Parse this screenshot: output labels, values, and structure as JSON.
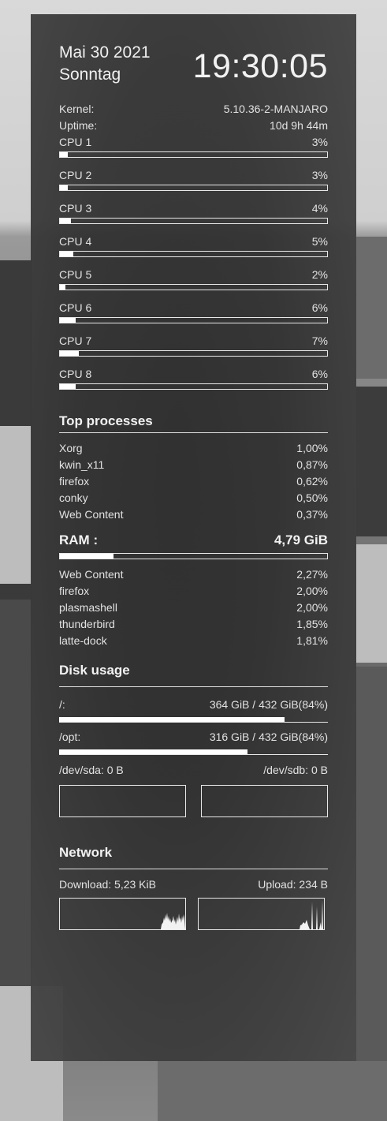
{
  "header": {
    "date": "Mai 30 2021",
    "weekday": "Sonntag",
    "time": "19:30:05"
  },
  "system": {
    "kernel_label": "Kernel:",
    "kernel_value": "5.10.36-2-MANJARO",
    "uptime_label": "Uptime:",
    "uptime_value": "10d 9h 44m"
  },
  "cpus": [
    {
      "label": "CPU 1",
      "value": "3%",
      "percent": 3
    },
    {
      "label": "CPU 2",
      "value": "3%",
      "percent": 3
    },
    {
      "label": "CPU 3",
      "value": "4%",
      "percent": 4
    },
    {
      "label": "CPU 4",
      "value": "5%",
      "percent": 5
    },
    {
      "label": "CPU 5",
      "value": "2%",
      "percent": 2
    },
    {
      "label": "CPU 6",
      "value": "6%",
      "percent": 6
    },
    {
      "label": "CPU 7",
      "value": "7%",
      "percent": 7
    },
    {
      "label": "CPU 8",
      "value": "6%",
      "percent": 6
    }
  ],
  "top_processes": {
    "title": "Top processes",
    "items": [
      {
        "name": "Xorg",
        "value": "1,00%"
      },
      {
        "name": "kwin_x11",
        "value": "0,87%"
      },
      {
        "name": "firefox",
        "value": "0,62%"
      },
      {
        "name": "conky",
        "value": "0,50%"
      },
      {
        "name": "Web Content",
        "value": "0,37%"
      }
    ]
  },
  "ram": {
    "title": "RAM :",
    "value": "4,79 GiB",
    "percent": 20,
    "items": [
      {
        "name": "Web Content",
        "value": "2,27%"
      },
      {
        "name": "firefox",
        "value": "2,00%"
      },
      {
        "name": "plasmashell",
        "value": "2,00%"
      },
      {
        "name": "thunderbird",
        "value": "1,85%"
      },
      {
        "name": "latte-dock",
        "value": "1,81%"
      }
    ]
  },
  "disk": {
    "title": "Disk usage",
    "root_label": "/:",
    "root_value": "364 GiB / 432 GiB(84%)",
    "root_percent": 84,
    "opt_label": "/opt:",
    "opt_value": "316 GiB / 432 GiB(84%)",
    "opt_percent": 70,
    "sda": "/dev/sda: 0 B",
    "sdb": "/dev/sdb: 0 B"
  },
  "network": {
    "title": "Network",
    "download": "Download: 5,23 KiB",
    "upload": "Upload: 234 B"
  }
}
